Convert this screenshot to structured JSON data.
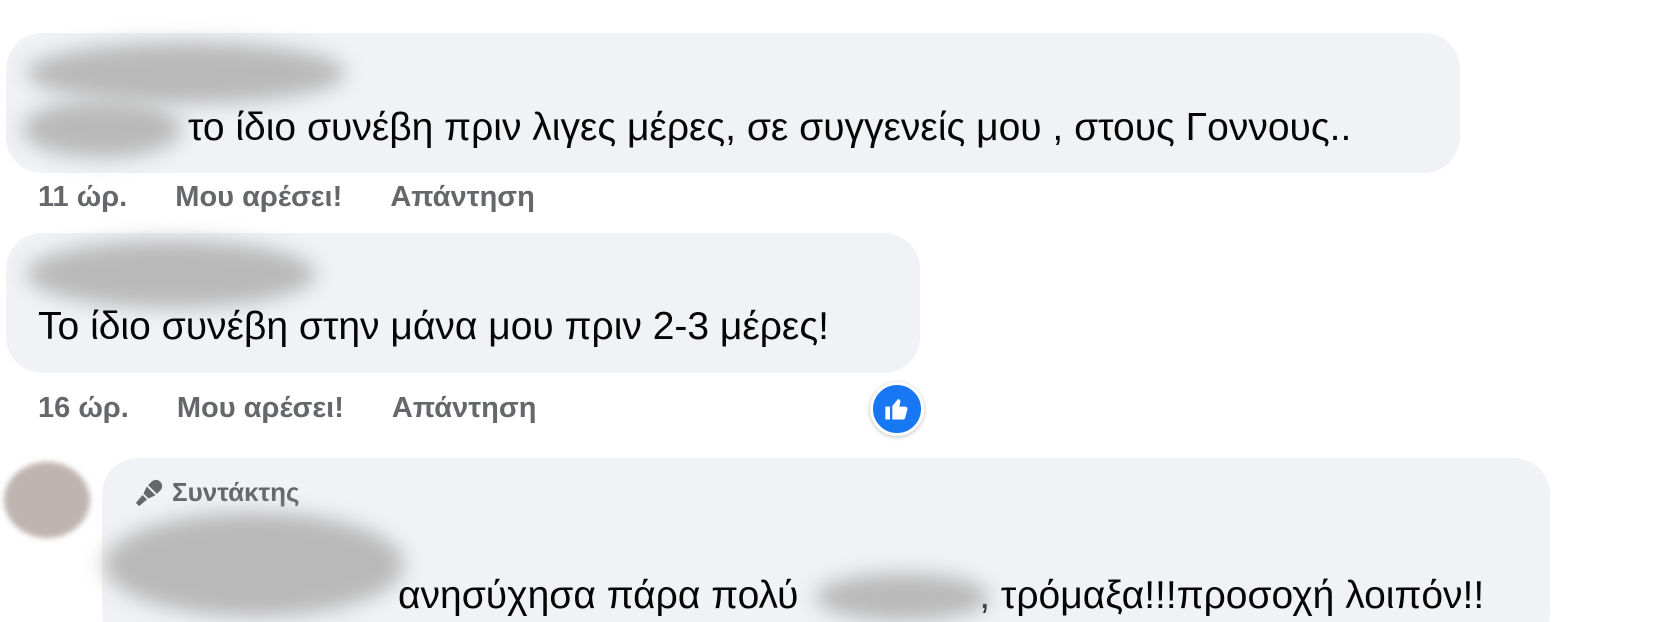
{
  "comments": [
    {
      "text": "το ίδιο συνέβη πριν λιγες μέρες, σε συγγενείς μου , στους Γοννους..",
      "time": "11 ώρ.",
      "like_label": "Μου αρέσει!",
      "reply_label": "Απάντηση"
    },
    {
      "text": "Το ίδιο συνέβη στην μάνα μου πριν 2-3 μέρες!",
      "time": "16 ώρ.",
      "like_label": "Μου αρέσει!",
      "reply_label": "Απάντηση",
      "reaction_icon": "thumbs-up-icon"
    },
    {
      "badge": "Συντάκτης",
      "badge_icon": "microphone-icon",
      "text_part1": "ανησύχησα πάρα πολύ ",
      "text_part2": ", τρόμαξα!!!προσοχή λοιπόν!!"
    }
  ],
  "colors": {
    "bubble": "#f0f2f5",
    "meta_text": "#65676b",
    "like_blue": "#1877f2"
  }
}
